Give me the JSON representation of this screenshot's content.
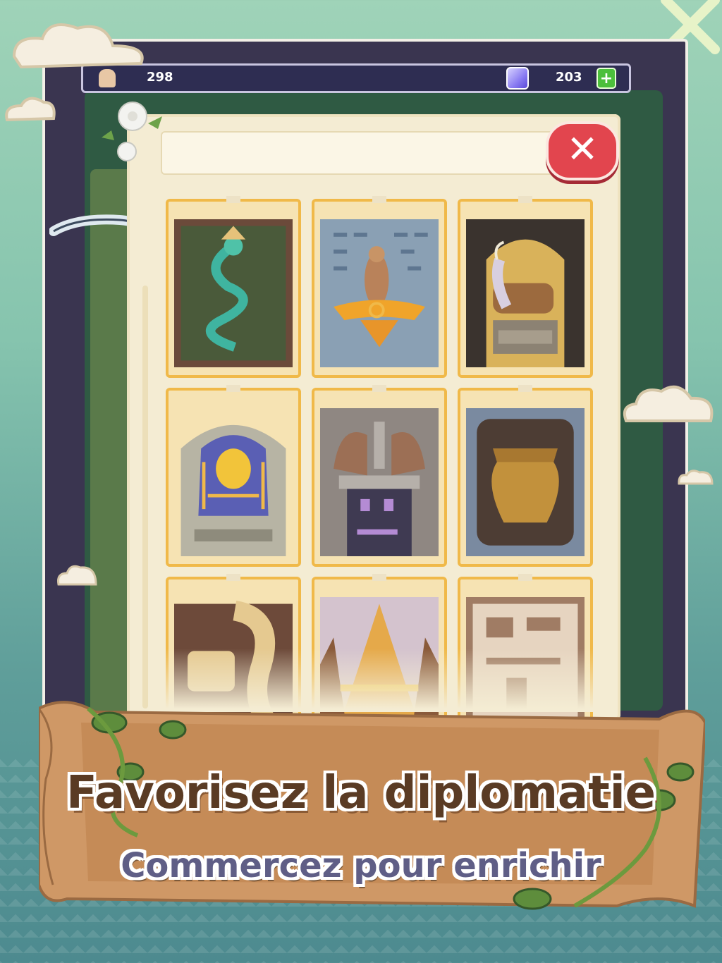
{
  "resources": {
    "population_value": "298",
    "gems_value": "203",
    "population_icon": "person-icon",
    "gem_icon": "gem-icon",
    "add_icon": "plus-icon"
  },
  "close_icon": "close-icon",
  "close_symbol": "✕",
  "plus_symbol": "+",
  "cards": [
    {
      "name": "dragon-relic-card",
      "icon": "dragon-icon"
    },
    {
      "name": "persian-relief-card",
      "icon": "relief-icon"
    },
    {
      "name": "winged-bull-card",
      "icon": "bull-icon"
    },
    {
      "name": "pharaoh-mask-card",
      "icon": "pharaoh-icon"
    },
    {
      "name": "lion-gate-card",
      "icon": "gate-icon"
    },
    {
      "name": "bronze-pot-card",
      "icon": "pot-icon"
    },
    {
      "name": "serpent-stone-card",
      "icon": "serpent-icon"
    },
    {
      "name": "pyramid-card",
      "icon": "pyramid-icon"
    },
    {
      "name": "ruins-map-card",
      "icon": "ruins-icon"
    }
  ],
  "banner": {
    "title": "Favorisez la diplomatie",
    "subtitle": "Commercez pour enrichir"
  },
  "colors": {
    "card_border": "#f0b949",
    "close_button": "#e2454e",
    "plus_button": "#4cbf3c",
    "topbar": "#2e2d52",
    "title_text": "#5a3b24",
    "subtitle_text": "#5f5e86"
  }
}
